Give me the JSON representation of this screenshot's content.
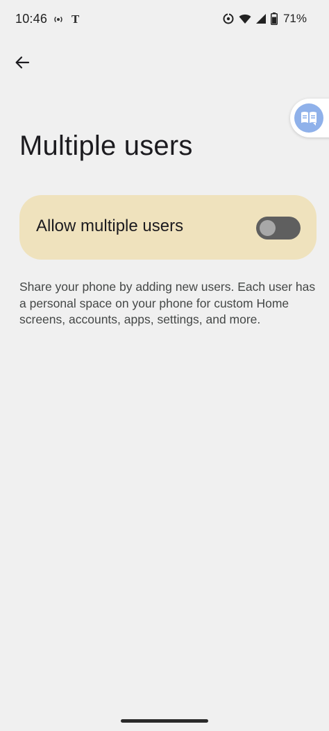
{
  "status_bar": {
    "time": "10:46",
    "left_icons": [
      "hotspot-icon",
      "nyt-icon"
    ],
    "right_icons": [
      "data-saver-icon",
      "wifi-icon",
      "signal-icon",
      "battery-icon"
    ],
    "battery_percent": "71%"
  },
  "header": {
    "back_icon": "arrow-back-icon",
    "title": "Multiple users"
  },
  "floating_bubble": {
    "icon": "reader-translate-icon",
    "color": "#8fb1ea"
  },
  "main_toggle": {
    "label": "Allow multiple users",
    "checked": false,
    "card_color": "#efe2bd"
  },
  "description": "Share your phone by adding new users. Each user has a personal space on your phone for custom Home screens, accounts, apps, settings, and more."
}
